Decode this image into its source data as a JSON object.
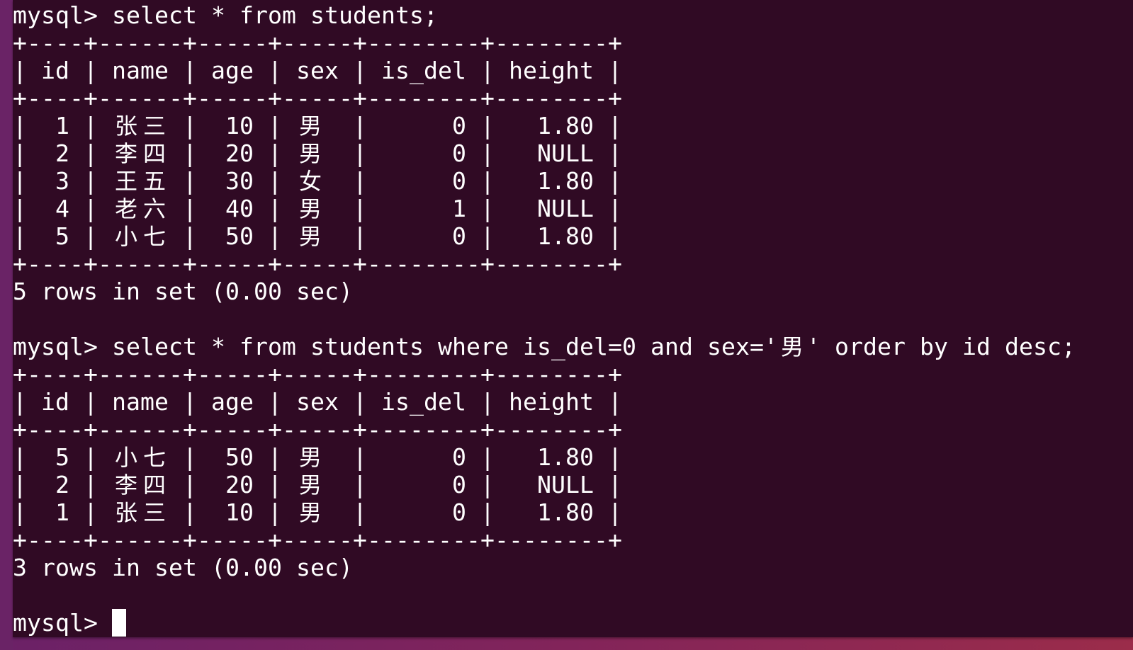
{
  "terminal": {
    "prompt": "mysql> ",
    "background": "#300a24",
    "foreground": "#ffffff",
    "blocks": [
      {
        "command": "select * from students;",
        "columns": [
          "id",
          "name",
          "age",
          "sex",
          "is_del",
          "height"
        ],
        "rows": [
          [
            "1",
            "张三",
            "10",
            "男",
            "0",
            "1.80"
          ],
          [
            "2",
            "李四",
            "20",
            "男",
            "0",
            "NULL"
          ],
          [
            "3",
            "王五",
            "30",
            "女",
            "0",
            "1.80"
          ],
          [
            "4",
            "老六",
            "40",
            "男",
            "1",
            "NULL"
          ],
          [
            "5",
            "小七",
            "50",
            "男",
            "0",
            "1.80"
          ]
        ],
        "result_summary": "5 rows in set (0.00 sec)"
      },
      {
        "command": "select * from students where is_del=0 and sex='男' order by id desc;",
        "columns": [
          "id",
          "name",
          "age",
          "sex",
          "is_del",
          "height"
        ],
        "rows": [
          [
            "5",
            "小七",
            "50",
            "男",
            "0",
            "1.80"
          ],
          [
            "2",
            "李四",
            "20",
            "男",
            "0",
            "NULL"
          ],
          [
            "1",
            "张三",
            "10",
            "男",
            "0",
            "1.80"
          ]
        ],
        "result_summary": "3 rows in set (0.00 sec)"
      }
    ],
    "current_input": ""
  }
}
